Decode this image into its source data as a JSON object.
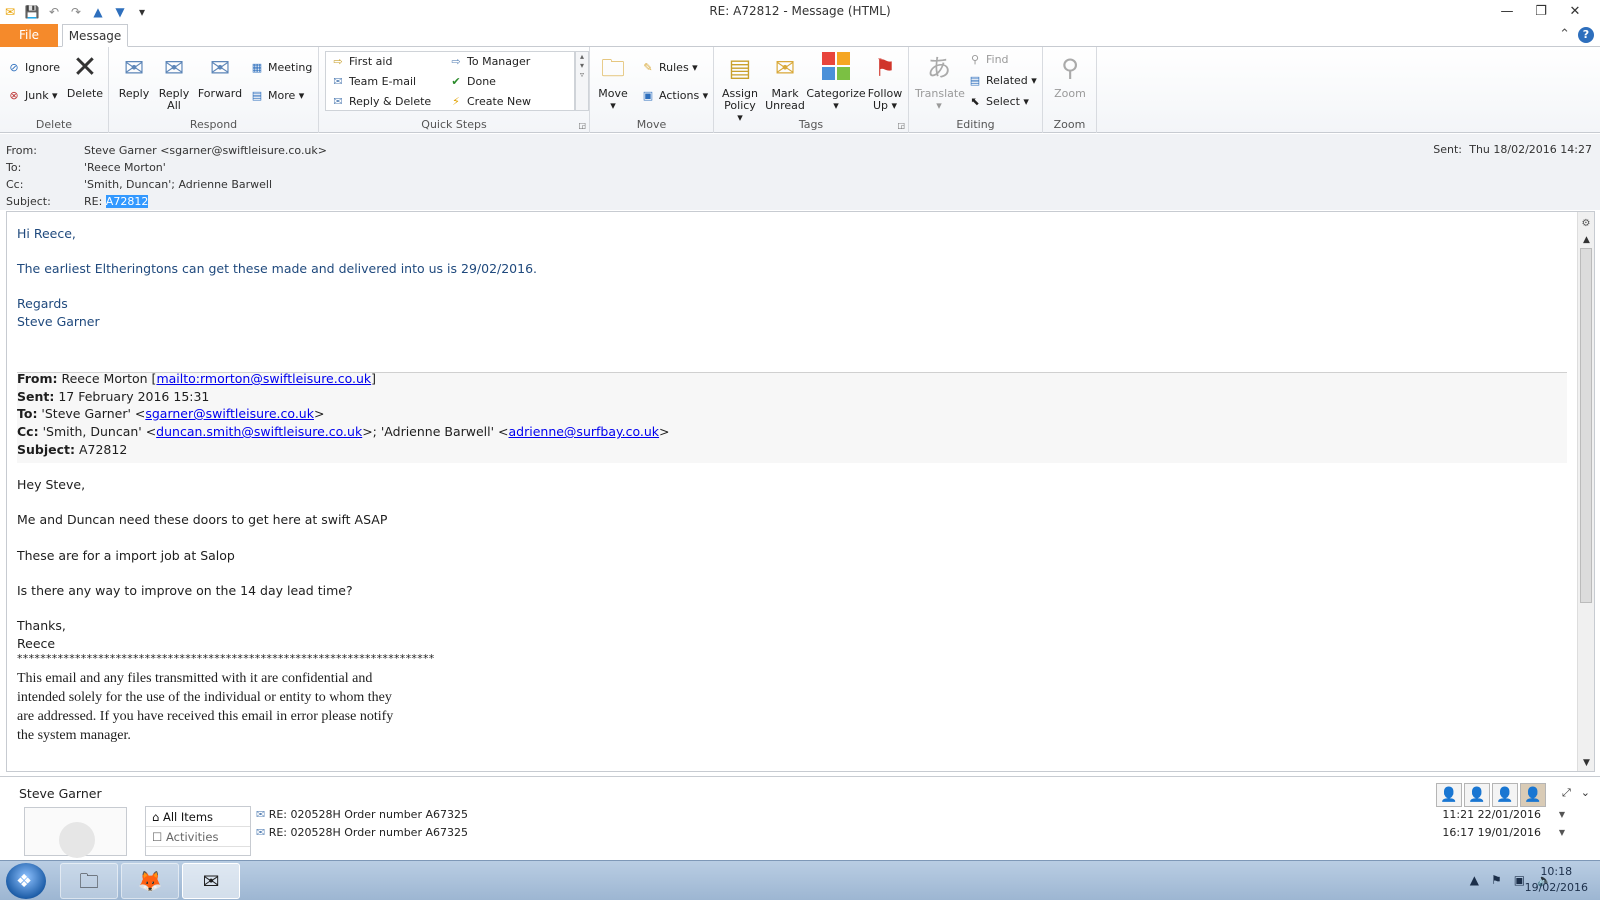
{
  "window": {
    "title": "RE: A72812  -  Message (HTML)",
    "controls": {
      "minimize": "—",
      "restore": "❐",
      "close": "✕"
    }
  },
  "tabs": {
    "file": "File",
    "message": "Message"
  },
  "ribbon": {
    "delete": {
      "label": "Delete",
      "ignore": "Ignore",
      "junk": "Junk",
      "delete": "Delete"
    },
    "respond": {
      "label": "Respond",
      "reply": "Reply",
      "reply_all_1": "Reply",
      "reply_all_2": "All",
      "forward": "Forward",
      "meeting": "Meeting",
      "more": "More"
    },
    "quick_steps": {
      "label": "Quick Steps",
      "items": [
        "First aid",
        "Team E-mail",
        "Reply & Delete",
        "To Manager",
        "Done",
        "Create New"
      ]
    },
    "move": {
      "label": "Move",
      "move": "Move",
      "rules": "Rules",
      "actions": "Actions"
    },
    "tags": {
      "label": "Tags",
      "assign_1": "Assign",
      "assign_2": "Policy",
      "mark_1": "Mark",
      "mark_2": "Unread",
      "categorize": "Categorize",
      "follow_1": "Follow",
      "follow_2": "Up"
    },
    "editing": {
      "label": "Editing",
      "translate": "Translate",
      "find": "Find",
      "related": "Related",
      "select": "Select"
    },
    "zoom": {
      "label": "Zoom",
      "zoom": "Zoom"
    }
  },
  "header": {
    "from_label": "From:",
    "from": "Steve Garner <sgarner@swiftleisure.co.uk>",
    "to_label": "To:",
    "to": "'Reece Morton'",
    "cc_label": "Cc:",
    "cc": "'Smith, Duncan'; Adrienne Barwell",
    "subject_label": "Subject:",
    "subject_prefix": "RE: ",
    "subject_highlight": "A72812",
    "sent_label": "Sent:",
    "sent": "Thu 18/02/2016 14:27"
  },
  "body": {
    "greeting": "Hi Reece,",
    "line1": "The earliest Eltheringtons can get these made and delivered into us is 29/02/2016.",
    "regards": "Regards",
    "signature": "Steve Garner",
    "orig": {
      "from_label": "From:",
      "from_text": " Reece Morton [",
      "from_link": "mailto:rmorton@swiftleisure.co.uk",
      "from_end": "]",
      "sent_label": "Sent:",
      "sent": " 17 February 2016 15:31",
      "to_label": "To:",
      "to_text": " 'Steve Garner' <",
      "to_link": "sgarner@swiftleisure.co.uk",
      "to_end": ">",
      "cc_label": "Cc:",
      "cc_text": " 'Smith, Duncan' <",
      "cc_link1": "duncan.smith@swiftleisure.co.uk",
      "cc_mid": ">; 'Adrienne Barwell' <",
      "cc_link2": "adrienne@surfbay.co.uk",
      "cc_end": ">",
      "subject_label": "Subject:",
      "subject": " A72812"
    },
    "hey": "Hey Steve,",
    "p1": "Me and Duncan need these doors to get here at swift ASAP",
    "p2": "These are for a import job at Salop",
    "p3": "Is there any way to improve on the 14 day lead time?",
    "thanks": "Thanks,",
    "reece": "Reece",
    "stars": "************************************************************************",
    "disclaimer": [
      "This email and any files transmitted with it are confidential and",
      "intended solely for the use of the individual or entity to whom they",
      "are addressed. If you have received this email in error please notify",
      "the system manager."
    ]
  },
  "people_pane": {
    "name": "Steve Garner",
    "filter_all": "All Items",
    "filter_activities": "Activities",
    "rows": [
      {
        "subject": "RE: 020528H Order number A67325",
        "date": "11:21  22/01/2016"
      },
      {
        "subject": "RE: 020528H Order number A67325",
        "date": "16:17  19/01/2016"
      }
    ]
  },
  "taskbar": {
    "time": "10:18",
    "date": "19/02/2016"
  },
  "colors": {
    "file_tab": "#f58a2b",
    "body_blue": "#1f497d",
    "link": "#0000ee",
    "highlight": "#3399ff"
  }
}
